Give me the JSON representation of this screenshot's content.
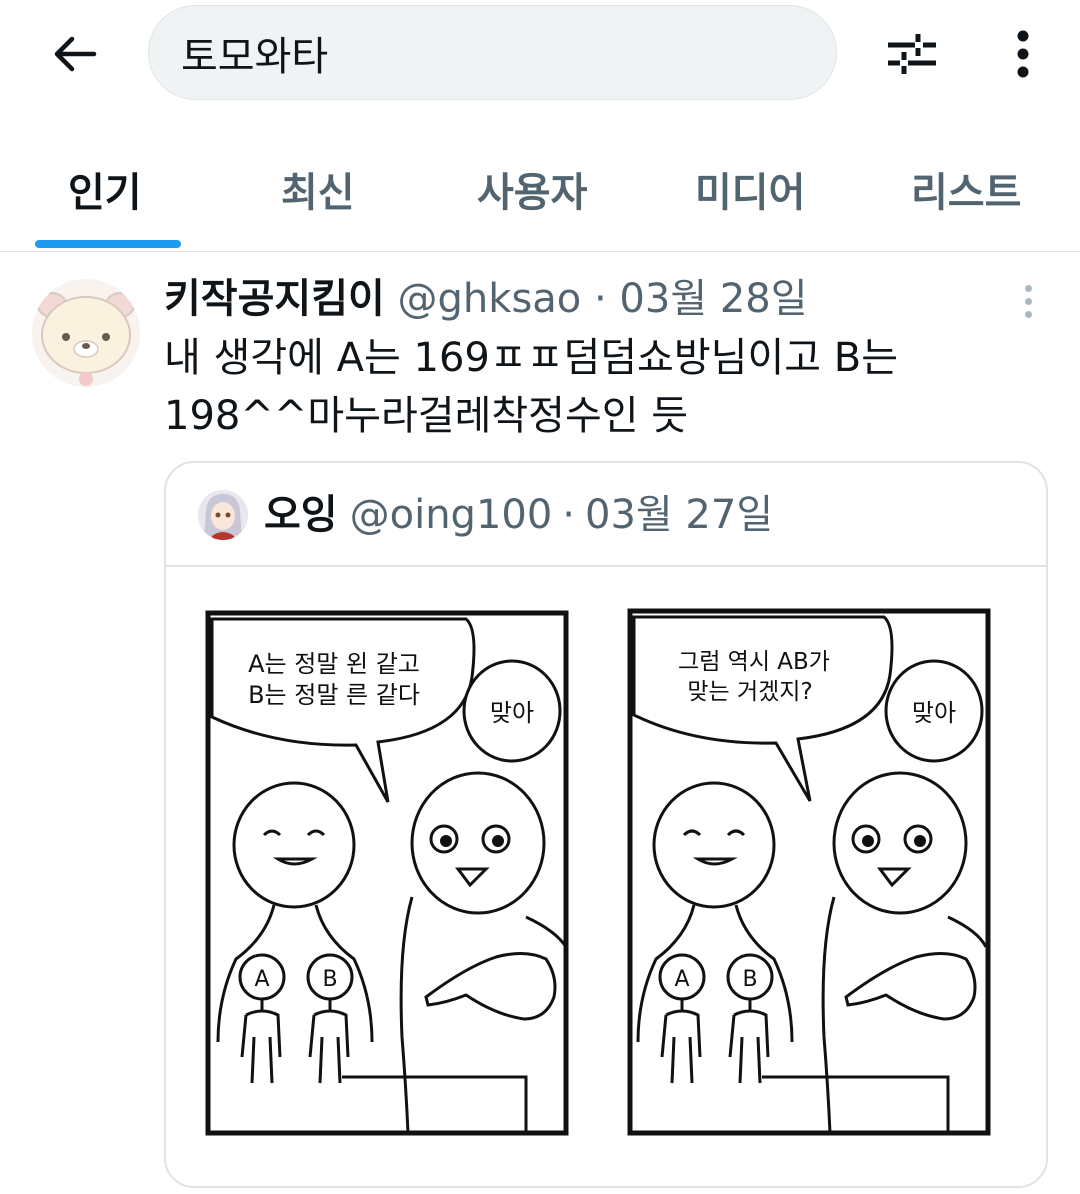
{
  "header": {
    "search_value": "토모와타"
  },
  "tabs": [
    {
      "label": "인기",
      "active": true
    },
    {
      "label": "최신",
      "active": false
    },
    {
      "label": "사용자",
      "active": false
    },
    {
      "label": "미디어",
      "active": false
    },
    {
      "label": "리스트",
      "active": false
    }
  ],
  "tweet": {
    "display_name": "키작공지킴이",
    "handle": "@ghksao",
    "separator": "·",
    "date": "03월 28일",
    "text_line1": "내 생각에 A는 169ㅍㅍ덤덤쇼방님이고 B는",
    "text_line2": "198^^마누라걸레착정수인 듯",
    "quoted": {
      "display_name": "오잉",
      "handle": "@oing100",
      "separator": "·",
      "date": "03월 27일",
      "comic": {
        "panel1_bubble_line1": "A는 정말 왼 같고",
        "panel1_bubble_line2": "B는 정말 른 같다",
        "panel1_reply": "맞아",
        "panel2_bubble_line1": "그럼 역시 AB가",
        "panel2_bubble_line2": "맞는 거겠지?",
        "panel2_reply": "맞아",
        "figure_a": "A",
        "figure_b": "B"
      }
    }
  },
  "colors": {
    "accent": "#1d9bf0",
    "text_primary": "#0f1419",
    "text_secondary": "#536471",
    "border": "#dfe3e6"
  }
}
